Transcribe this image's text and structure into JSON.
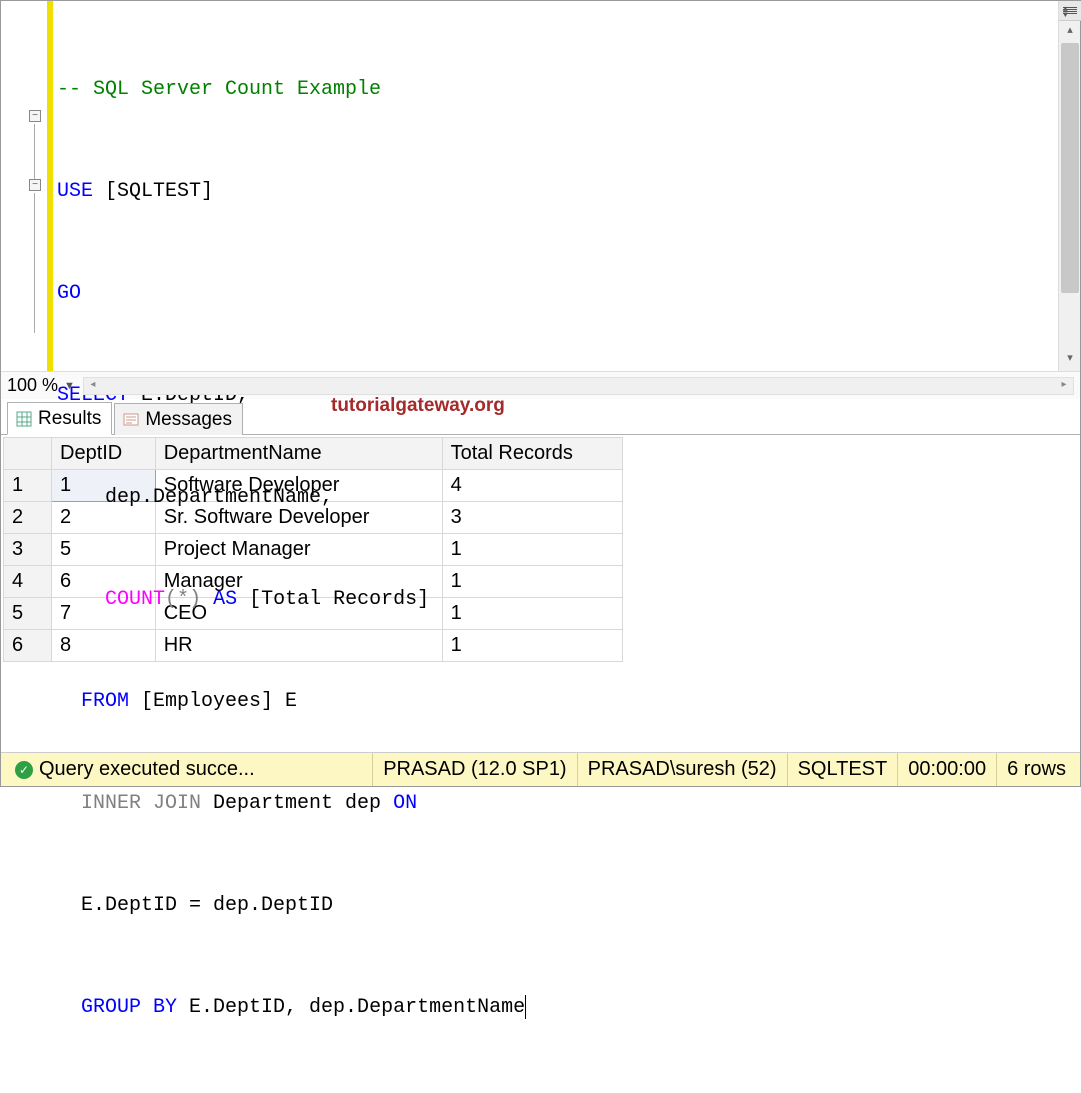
{
  "editor": {
    "comment": "-- SQL Server Count Example",
    "line2_use": "USE",
    "line2_db": " [SQLTEST]",
    "line3": "GO",
    "line4_select": "SELECT",
    "line4_rest": " E.DeptID,",
    "line5": "    dep.DepartmentName,",
    "line6_count": "    COUNT",
    "line6_paren_open": "(",
    "line6_star": "*",
    "line6_paren_close": ")",
    "line6_as": " AS",
    "line6_alias": " [Total Records]",
    "line7_from": "  FROM",
    "line7_rest": " [Employees] E",
    "line8_inner": "  INNER",
    "line8_join": " JOIN",
    "line8_mid": " Department dep ",
    "line8_on": "ON",
    "line9": "  E.DeptID = dep.DeptID",
    "line10_group": "  GROUP",
    "line10_by": " BY",
    "line10_rest": " E.DeptID, dep.DepartmentName"
  },
  "zoom": {
    "value": "100 %"
  },
  "watermark": "tutorialgateway.org",
  "tabs": {
    "results": "Results",
    "messages": "Messages"
  },
  "grid": {
    "headers": [
      "DeptID",
      "DepartmentName",
      "Total Records"
    ],
    "rows": [
      {
        "n": "1",
        "deptid": "1",
        "name": "Software Developer",
        "total": "4"
      },
      {
        "n": "2",
        "deptid": "2",
        "name": "Sr. Software Developer",
        "total": "3"
      },
      {
        "n": "3",
        "deptid": "5",
        "name": "Project Manager",
        "total": "1"
      },
      {
        "n": "4",
        "deptid": "6",
        "name": "Manager",
        "total": "1"
      },
      {
        "n": "5",
        "deptid": "7",
        "name": "CEO",
        "total": "1"
      },
      {
        "n": "6",
        "deptid": "8",
        "name": "HR",
        "total": "1"
      }
    ]
  },
  "status": {
    "message": "Query executed succe...",
    "server": "PRASAD (12.0 SP1)",
    "user": "PRASAD\\suresh (52)",
    "db": "SQLTEST",
    "time": "00:00:00",
    "rows": "6 rows"
  }
}
